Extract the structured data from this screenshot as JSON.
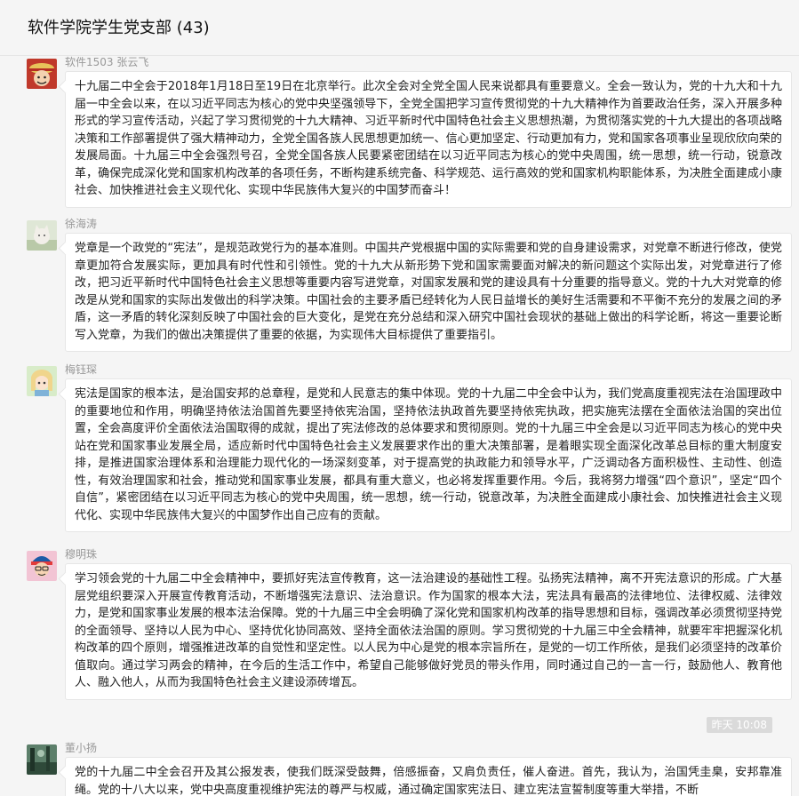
{
  "chat": {
    "title": "软件学院学生党支部 (43)",
    "timestamp": "昨天 10:08",
    "messages": [
      {
        "sender": "软件1503 张云飞",
        "avatar": "pirate-avatar-icon",
        "text": "十九届二中全会于2018年1月18日至19日在北京举行。此次全会对全党全国人民来说都具有重要意义。全会一致认为，党的十九大和十九届一中全会以来，在以习近平同志为核心的党中央坚强领导下，全党全国把学习宣传贯彻党的十九大精神作为首要政治任务，深入开展多种形式的学习宣传活动，兴起了学习贯彻党的十九大精神、习近平新时代中国特色社会主义思想热潮，为贯彻落实党的十九大提出的各项战略决策和工作部署提供了强大精神动力，全党全国各族人民思想更加统一、信心更加坚定、行动更加有力，党和国家各项事业呈现欣欣向荣的发展局面。十九届三中全会强烈号召，全党全国各族人民要紧密团结在以习近平同志为核心的党中央周围，统一思想，统一行动，锐意改革，确保完成深化党和国家机构改革的各项任务，不断构建系统完备、科学规范、运行高效的党和国家机构职能体系，为决胜全面建成小康社会、加快推进社会主义现代化、实现中华民族伟大复兴的中国梦而奋斗！"
      },
      {
        "sender": "徐海涛",
        "avatar": "cat-avatar-icon",
        "text": "党章是一个政党的“宪法”，是规范政党行为的基本准则。中国共产党根据中国的实际需要和党的自身建设需求，对党章不断进行修改，使党章更加符合发展实际，更加具有时代性和引领性。党的十九大从新形势下党和国家需要面对解决的新问题这个实际出发，对党章进行了修改，把习近平新时代中国特色社会主义思想等重要内容写进党章，对国家发展和党的建设具有十分重要的指导意义。党的十九大对党章的修改是从党和国家的实际出发做出的科学决策。中国社会的主要矛盾已经转化为人民日益增长的美好生活需要和不平衡不充分的发展之间的矛盾，这一矛盾的转化深刻反映了中国社会的巨大变化，是党在充分总结和深入研究中国社会现状的基础上做出的科学论断，将这一重要论断写入党章，为我们的做出决策提供了重要的依据，为实现伟大目标提供了重要指引。"
      },
      {
        "sender": "梅钰琛",
        "avatar": "anime-girl-avatar-icon",
        "text": "宪法是国家的根本法，是治国安邦的总章程，是党和人民意志的集中体现。党的十九届二中全会中认为，我们党高度重视宪法在治国理政中的重要地位和作用，明确坚持依法治国首先要坚持依宪治国，坚持依法执政首先要坚持依宪执政，把实施宪法摆在全面依法治国的突出位置，全会高度评价全面依法治国取得的成就，提出了宪法修改的总体要求和贯彻原则。党的十九届三中全会是以习近平同志为核心的党中央站在党和国家事业发展全局，适应新时代中国特色社会主义发展要求作出的重大决策部署，是着眼实现全面深化改革总目标的重大制度安排，是推进国家治理体系和治理能力现代化的一场深刻变革，对于提高党的执政能力和领导水平，广泛调动各方面积极性、主动性、创造性，有效治理国家和社会，推动党和国家事业发展，都具有重大意义，也必将发挥重要作用。今后，我将努力增强“四个意识”，坚定“四个自信”，紧密团结在以习近平同志为核心的党中央周围，统一思想，统一行动，锐意改革，为决胜全面建成小康社会、加快推进社会主义现代化、实现中华民族伟大复兴的中国梦作出自己应有的贡献。"
      },
      {
        "sender": "穆明珠",
        "avatar": "cartoon-boy-avatar-icon",
        "text": "学习领会党的十九届二中全会精神中，要抓好宪法宣传教育，这一法治建设的基础性工程。弘扬宪法精神，离不开宪法意识的形成。广大基层党组织要深入开展宣传教育活动，不断增强宪法意识、法治意识。作为国家的根本大法，宪法具有最高的法律地位、法律权威、法律效力，是党和国家事业发展的根本法治保障。党的十九届三中全会明确了深化党和国家机构改革的指导思想和目标，强调改革必须贯彻坚持党的全面领导、坚持以人民为中心、坚持优化协同高效、坚持全面依法治国的原则。学习贯彻党的十九届三中全会精神，就要牢牢把握深化机构改革的四个原则，增强推进改革的自觉性和坚定性。以人民为中心是党的根本宗旨所在，是党的一切工作所依，是我们必须坚持的改革价值取向。通过学习两会的精神，在今后的生活工作中，希望自己能够做好党员的带头作用，同时通过自己的一言一行，鼓励他人、教育他人、融入他人，从而为我国特色社会主义建设添砖增瓦。"
      },
      {
        "sender": "董小扬",
        "avatar": "landscape-avatar-icon",
        "text": "党的十九届二中全会召开及其公报发表，使我们既深受鼓舞，倍感振奋，又肩负责任，催人奋进。首先，我认为，治国凭圭臬，安邦靠准绳。党的十八大以来，党中央高度重视维护宪法的尊严与权威，通过确定国家宪法日、建立宪法宣誓制度等重大举措，不断"
      }
    ]
  }
}
